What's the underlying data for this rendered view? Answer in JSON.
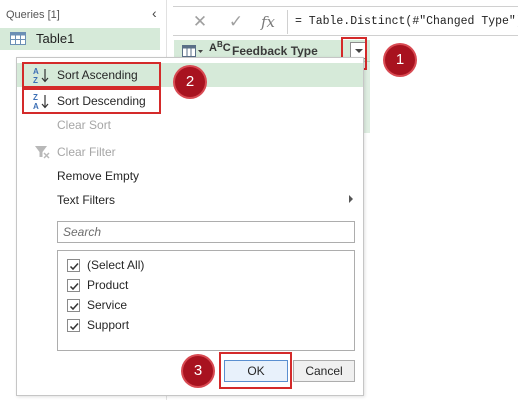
{
  "queries": {
    "header": "Queries [1]",
    "items": [
      {
        "label": "Table1"
      }
    ]
  },
  "formula_bar": {
    "cancel_icon": "x-icon",
    "accept_icon": "check-icon",
    "fx_label": "fx",
    "formula": "= Table.Distinct(#\"Changed Type\")"
  },
  "column": {
    "type_label": "ABC",
    "name": "Feedback Type"
  },
  "menu": {
    "items": [
      {
        "label": "Sort Ascending",
        "icon": "sort-ascending-icon",
        "disabled": false
      },
      {
        "label": "Sort Descending",
        "icon": "sort-descending-icon",
        "disabled": false
      },
      {
        "label": "Clear Sort",
        "disabled": true
      },
      {
        "label": "Clear Filter",
        "icon": "clear-filter-icon",
        "disabled": true
      },
      {
        "label": "Remove Empty",
        "disabled": false
      },
      {
        "label": "Text Filters",
        "has_submenu": true,
        "disabled": false
      }
    ],
    "search_placeholder": "Search",
    "values": [
      {
        "label": "(Select All)",
        "checked": true
      },
      {
        "label": "Product",
        "checked": true
      },
      {
        "label": "Service",
        "checked": true
      },
      {
        "label": "Support",
        "checked": true
      }
    ],
    "ok_label": "OK",
    "cancel_label": "Cancel"
  },
  "badges": [
    "1",
    "2",
    "3"
  ],
  "colors": {
    "accent_green": "#d6ead9",
    "callout_red": "#d42a2a",
    "badge_red": "#a8121f"
  }
}
